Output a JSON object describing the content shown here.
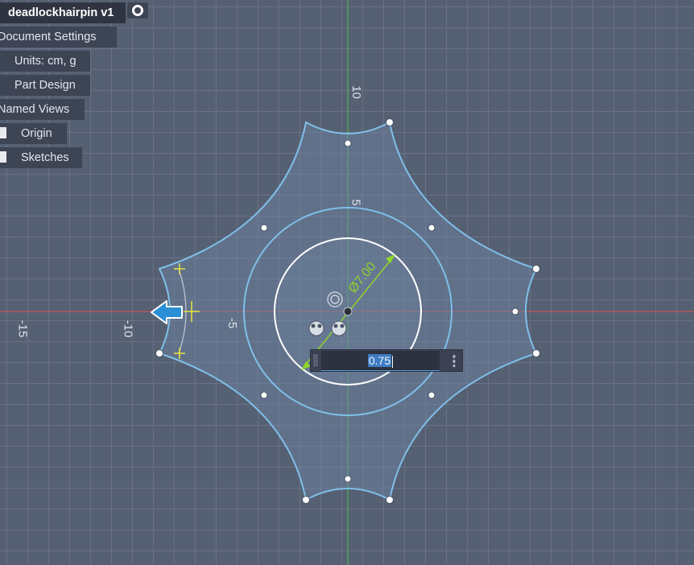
{
  "browser": {
    "title": "deadlockhairpin v1",
    "items": [
      {
        "label": "Document Settings"
      },
      {
        "label": "Units: cm, g"
      },
      {
        "label": "Part Design"
      },
      {
        "label": "Named Views"
      },
      {
        "label": "Origin"
      },
      {
        "label": "Sketches"
      }
    ]
  },
  "axis_ticks": {
    "x": [
      "-15",
      "-10",
      "-5"
    ],
    "y": [
      "10",
      "5"
    ]
  },
  "dimension": {
    "diameter_label": "Ø7.00"
  },
  "dimension_input": {
    "value": "0.75"
  },
  "colors": {
    "canvas_bg": "#566073",
    "grid_line": "#76809a",
    "x_axis": "#d9534f",
    "y_axis": "#4fbf4f",
    "sketch_curve": "#7fbfe8",
    "profile_fill": "#6f87a6",
    "selected_circle": "#ffffff",
    "dimension": "#8fd62a",
    "constraint_marker": "#e8e640",
    "drag_arrow": "#2a8fd6"
  },
  "icons": [
    "visibility-toggle-icon",
    "radio-target-icon",
    "move-arrow-icon",
    "center-point-icon",
    "sketch-constraint-icon",
    "grip-icon",
    "more-options-icon"
  ]
}
